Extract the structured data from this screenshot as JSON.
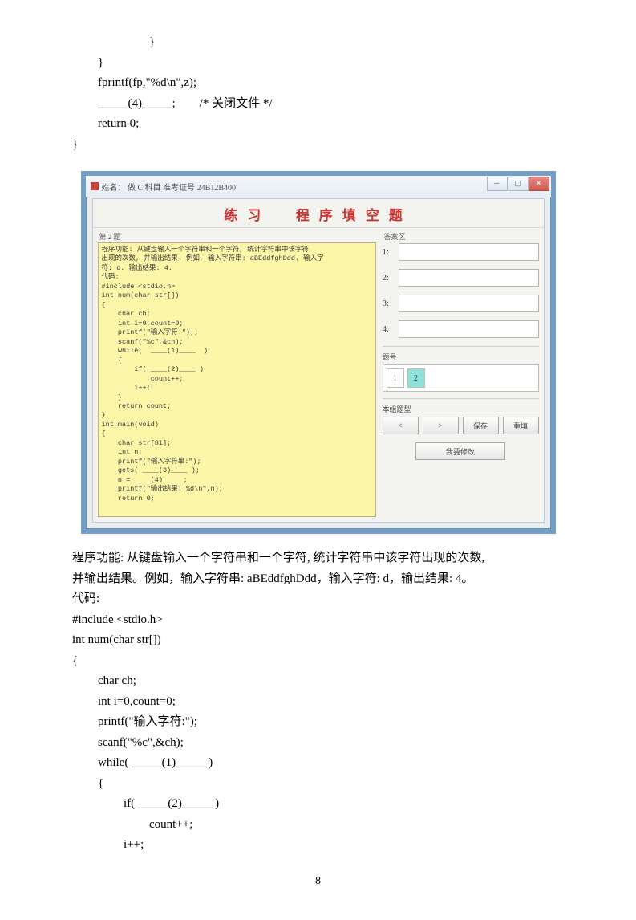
{
  "top_code": {
    "l1": "}",
    "l2": "}",
    "l3": "fprintf(fp,\"%d\\n\",z);",
    "l4": "_____(4)_____;",
    "l4c": "/*  关闭文件  */",
    "l5": "return 0;",
    "l6": "}"
  },
  "app": {
    "title": "姓名：   做 C 科目     准考证号 24B12B400",
    "header_a": "练习",
    "header_b": "程序填空题",
    "left_label": "第 2 题",
    "code": "程序功能: 从键盘输入一个字符串和一个字符, 统计字符串中该字符\n出现的次数, 并输出结果. 例如, 输入字符串: aBEddfghDdd. 输入字\n符: d. 输出结果: 4.\n代码:\n#include <stdio.h>\nint num(char str[])\n{\n    char ch;\n    int i=0,count=0;\n    printf(\"输入字符:\");;\n    scanf(\"%c\",&ch);\n    while(  ____(1)____  )\n    {\n        if( ____(2)____ )\n            count++;\n        i++;\n    }\n    return count;\n}\nint main(void)\n{\n    char str[81];\n    int n;\n    printf(\"输入字符串:\");\n    gets( ____(3)____ );\n    n = ____(4)____ ;\n    printf(\"输出结果: %d\\n\",n);\n    return 0;",
    "answer_label": "答案区",
    "ans": [
      "1:",
      "2:",
      "3:",
      "4:"
    ],
    "nav_label": "题号",
    "nav_items": [
      "1",
      "2"
    ],
    "btns_label": "本组题型",
    "btn_prev": "<",
    "btn_next": ">",
    "btn_save": "保存",
    "btn_reset": "重填",
    "btn_big": "我要修改"
  },
  "para": {
    "p1": "程序功能: 从键盘输入一个字符串和一个字符, 统计字符串中该字符出现的次数,",
    "p2": "并输出结果。例如，输入字符串:  aBEddfghDdd，输入字符:  d，输出结果:  4。",
    "p3": "代码:",
    "c1": "#include <stdio.h>",
    "c2": "int num(char str[])",
    "c3": "{",
    "c4": "char ch;",
    "c5": "int i=0,count=0;",
    "c6": "printf(\"输入字符:\");",
    "c7": "scanf(\"%c\",&ch);",
    "c8": "while(    _____(1)_____  )",
    "c9": "{",
    "c10": "if(  _____(2)_____  )",
    "c11": "count++;",
    "c12": "i++;"
  },
  "page_number": "8"
}
